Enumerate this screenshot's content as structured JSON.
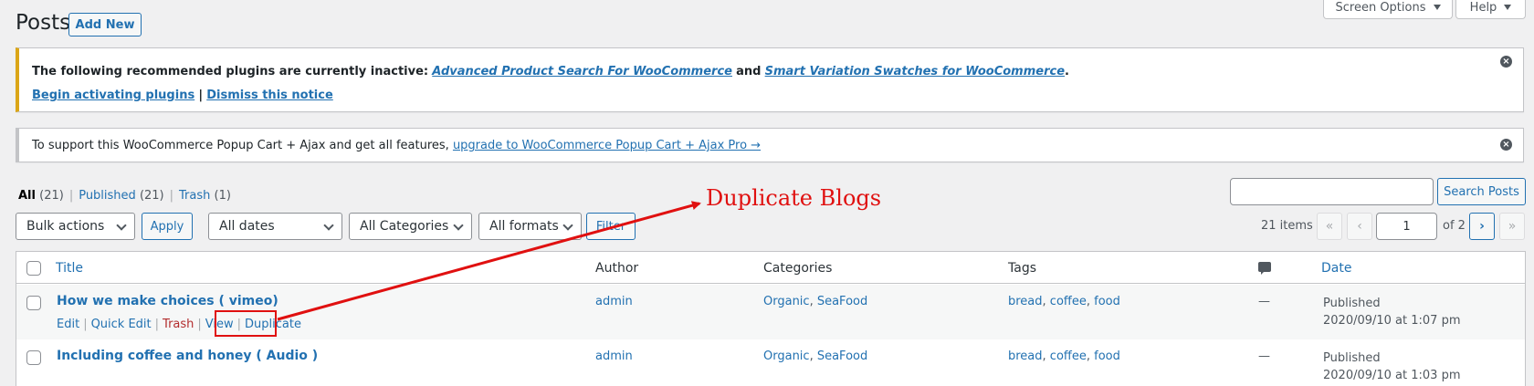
{
  "header": {
    "title": "Posts",
    "add_new": "Add New",
    "screen_options": "Screen Options",
    "help": "Help"
  },
  "notice_warning": {
    "prefix": "The following recommended plugins are currently inactive:",
    "plugin1": "Advanced Product Search For WooCommerce",
    "and": "and",
    "plugin2": "Smart Variation Swatches for WooCommerce",
    "period": ".",
    "begin": "Begin activating plugins",
    "divider": "|",
    "dismiss": "Dismiss this notice"
  },
  "notice_info": {
    "text": "To support this WooCommerce Popup Cart + Ajax and get all features,",
    "link": "upgrade to WooCommerce Popup Cart + Ajax Pro →"
  },
  "views": {
    "all_label": "All",
    "all_count": "(21)",
    "published_label": "Published",
    "published_count": "(21)",
    "trash_label": "Trash",
    "trash_count": "(1)",
    "sep": "|"
  },
  "search": {
    "value": "",
    "button": "Search Posts"
  },
  "filters": {
    "bulk": "Bulk actions",
    "apply": "Apply",
    "dates": "All dates",
    "categories": "All Categories",
    "formats": "All formats",
    "filter": "Filter"
  },
  "pagination": {
    "items": "21 items",
    "first": "«",
    "prev": "‹",
    "current": "1",
    "of": "of 2",
    "next": "›",
    "last": "»"
  },
  "table": {
    "headers": {
      "title": "Title",
      "author": "Author",
      "categories": "Categories",
      "tags": "Tags",
      "date": "Date"
    },
    "rows": [
      {
        "title": "How we make choices ( vimeo)",
        "author": "admin",
        "cat1": "Organic",
        "cat2": "SeaFood",
        "tag1": "bread",
        "tag2": "coffee",
        "tag3": "food",
        "comments": "—",
        "status": "Published",
        "date": "2020/09/10 at 1:07 pm",
        "actions": {
          "edit": "Edit",
          "quick_edit": "Quick Edit",
          "trash": "Trash",
          "view": "View",
          "duplicate": "Duplicate",
          "sep": "|"
        }
      },
      {
        "title": "Including coffee and honey ( Audio )",
        "author": "admin",
        "cat1": "Organic",
        "cat2": "SeaFood",
        "tag1": "bread",
        "tag2": "coffee",
        "tag3": "food",
        "comments": "—",
        "status": "Published",
        "date": "2020/09/10 at 1:03 pm"
      }
    ]
  },
  "annotation": {
    "text": "Duplicate Blogs",
    "color": "#e01010"
  },
  "colors": {
    "link": "#2271b1",
    "warning_border": "#dba617",
    "trash": "#b32d2e"
  }
}
